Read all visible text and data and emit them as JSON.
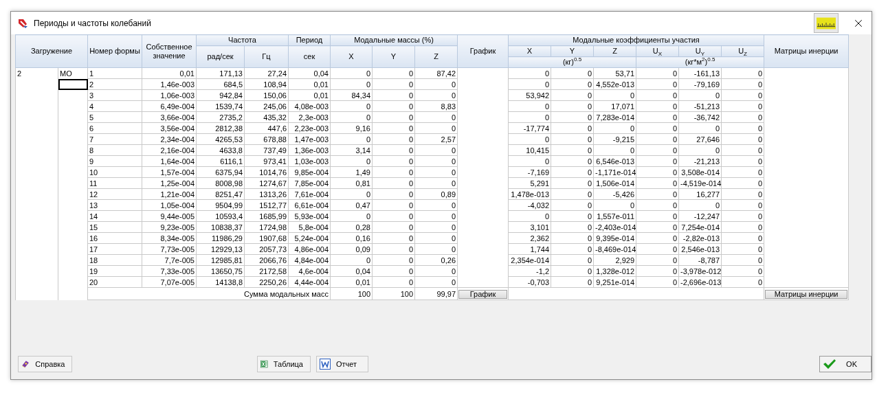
{
  "window": {
    "title": "Периоды и частоты колебаний"
  },
  "table": {
    "header": {
      "load": "Загружение",
      "form": "Номер формы",
      "eigen": "Собственное значение",
      "freq": "Частота",
      "freq_units": [
        "рад/сек",
        "Гц"
      ],
      "period": "Период",
      "period_unit": "сек",
      "masses": "Модальные массы (%)",
      "mass_axes": [
        "X",
        "Y",
        "Z"
      ],
      "chart": "График",
      "coeffs": "Модальные коэффициенты участия",
      "coeff_axes": [
        "X",
        "Y",
        "Z",
        "U$_{X}$",
        "U$_{Y}$",
        "U$_{Z}$"
      ],
      "coeff_units": [
        "(кг)$^{0.5}$",
        "(кг*м$^{2}$)$^{0.5}$"
      ],
      "inertia": "Матрицы инерции"
    },
    "load_case": {
      "number": "2",
      "name": "МО"
    },
    "rows": [
      {
        "focused": false,
        "cells": [
          "1",
          "0,01",
          "171,13",
          "27,24",
          "0,04",
          "0",
          "0",
          "87,42",
          "0",
          "0",
          "53,71",
          "0",
          "-161,13",
          "0"
        ]
      },
      {
        "focused": true,
        "cells": [
          "2",
          "1,46e-003",
          "684,5",
          "108,94",
          "0,01",
          "0",
          "0",
          "0",
          "0",
          "0",
          "4,552e-013",
          "0",
          "-79,169",
          "0"
        ]
      },
      {
        "focused": false,
        "cells": [
          "3",
          "1,06e-003",
          "942,84",
          "150,06",
          "0,01",
          "84,34",
          "0",
          "0",
          "53,942",
          "0",
          "0",
          "0",
          "0",
          "0"
        ]
      },
      {
        "focused": false,
        "cells": [
          "4",
          "6,49e-004",
          "1539,74",
          "245,06",
          "4,08e-003",
          "0",
          "0",
          "8,83",
          "0",
          "0",
          "17,071",
          "0",
          "-51,213",
          "0"
        ]
      },
      {
        "focused": false,
        "cells": [
          "5",
          "3,66e-004",
          "2735,2",
          "435,32",
          "2,3e-003",
          "0",
          "0",
          "0",
          "0",
          "0",
          "7,283e-014",
          "0",
          "-36,742",
          "0"
        ]
      },
      {
        "focused": false,
        "cells": [
          "6",
          "3,56e-004",
          "2812,38",
          "447,6",
          "2,23e-003",
          "9,16",
          "0",
          "0",
          "-17,774",
          "0",
          "0",
          "0",
          "0",
          "0"
        ]
      },
      {
        "focused": false,
        "cells": [
          "7",
          "2,34e-004",
          "4265,53",
          "678,88",
          "1,47e-003",
          "0",
          "0",
          "2,57",
          "0",
          "0",
          "-9,215",
          "0",
          "27,646",
          "0"
        ]
      },
      {
        "focused": false,
        "cells": [
          "8",
          "2,16e-004",
          "4633,8",
          "737,49",
          "1,36e-003",
          "3,14",
          "0",
          "0",
          "10,415",
          "0",
          "0",
          "0",
          "0",
          "0"
        ]
      },
      {
        "focused": false,
        "cells": [
          "9",
          "1,64e-004",
          "6116,1",
          "973,41",
          "1,03e-003",
          "0",
          "0",
          "0",
          "0",
          "0",
          "6,546e-013",
          "0",
          "-21,213",
          "0"
        ]
      },
      {
        "focused": false,
        "cells": [
          "10",
          "1,57e-004",
          "6375,94",
          "1014,76",
          "9,85e-004",
          "1,49",
          "0",
          "0",
          "-7,169",
          "0",
          "-1,171e-014",
          "0",
          "3,508e-014",
          "0"
        ]
      },
      {
        "focused": false,
        "cells": [
          "11",
          "1,25e-004",
          "8008,98",
          "1274,67",
          "7,85e-004",
          "0,81",
          "0",
          "0",
          "5,291",
          "0",
          "1,506e-014",
          "0",
          "-4,519e-014",
          "0"
        ]
      },
      {
        "focused": false,
        "cells": [
          "12",
          "1,21e-004",
          "8251,47",
          "1313,26",
          "7,61e-004",
          "0",
          "0",
          "0,89",
          "1,478e-013",
          "0",
          "-5,426",
          "0",
          "16,277",
          "0"
        ]
      },
      {
        "focused": false,
        "cells": [
          "13",
          "1,05e-004",
          "9504,99",
          "1512,77",
          "6,61e-004",
          "0,47",
          "0",
          "0",
          "-4,032",
          "0",
          "0",
          "0",
          "0",
          "0"
        ]
      },
      {
        "focused": false,
        "cells": [
          "14",
          "9,44e-005",
          "10593,4",
          "1685,99",
          "5,93e-004",
          "0",
          "0",
          "0",
          "0",
          "0",
          "1,557e-011",
          "0",
          "-12,247",
          "0"
        ]
      },
      {
        "focused": false,
        "cells": [
          "15",
          "9,23e-005",
          "10838,37",
          "1724,98",
          "5,8e-004",
          "0,28",
          "0",
          "0",
          "3,101",
          "0",
          "-2,403e-014",
          "0",
          "7,254e-014",
          "0"
        ]
      },
      {
        "focused": false,
        "cells": [
          "16",
          "8,34e-005",
          "11986,29",
          "1907,68",
          "5,24e-004",
          "0,16",
          "0",
          "0",
          "2,362",
          "0",
          "9,395e-014",
          "0",
          "-2,82e-013",
          "0"
        ]
      },
      {
        "focused": false,
        "cells": [
          "17",
          "7,73e-005",
          "12929,13",
          "2057,73",
          "4,86e-004",
          "0,09",
          "0",
          "0",
          "1,744",
          "0",
          "-8,469e-014",
          "0",
          "2,546e-013",
          "0"
        ]
      },
      {
        "focused": false,
        "cells": [
          "18",
          "7,7e-005",
          "12985,81",
          "2066,76",
          "4,84e-004",
          "0",
          "0",
          "0,26",
          "2,354e-014",
          "0",
          "2,929",
          "0",
          "-8,787",
          "0"
        ]
      },
      {
        "focused": false,
        "cells": [
          "19",
          "7,33e-005",
          "13650,75",
          "2172,58",
          "4,6e-004",
          "0,04",
          "0",
          "0",
          "-1,2",
          "0",
          "1,328e-012",
          "0",
          "-3,978e-012",
          "0"
        ]
      },
      {
        "focused": false,
        "cells": [
          "20",
          "7,07e-005",
          "14138,8",
          "2250,26",
          "4,44e-004",
          "0,01",
          "0",
          "0",
          "-0,703",
          "0",
          "9,251e-014",
          "0",
          "-2,696e-013",
          "0"
        ]
      }
    ],
    "sum_row": {
      "label": "Сумма модальных масс",
      "values": [
        "100",
        "100",
        "99,97"
      ],
      "chart_button": "График",
      "inertia_button": "Матрицы инерции"
    }
  },
  "buttons": [
    {
      "kind": "help",
      "label": "Справка"
    },
    {
      "kind": "excel",
      "label": "Таблица"
    },
    {
      "kind": "word",
      "label": "Отчет"
    },
    {
      "kind": "ok",
      "label": "OK"
    }
  ]
}
